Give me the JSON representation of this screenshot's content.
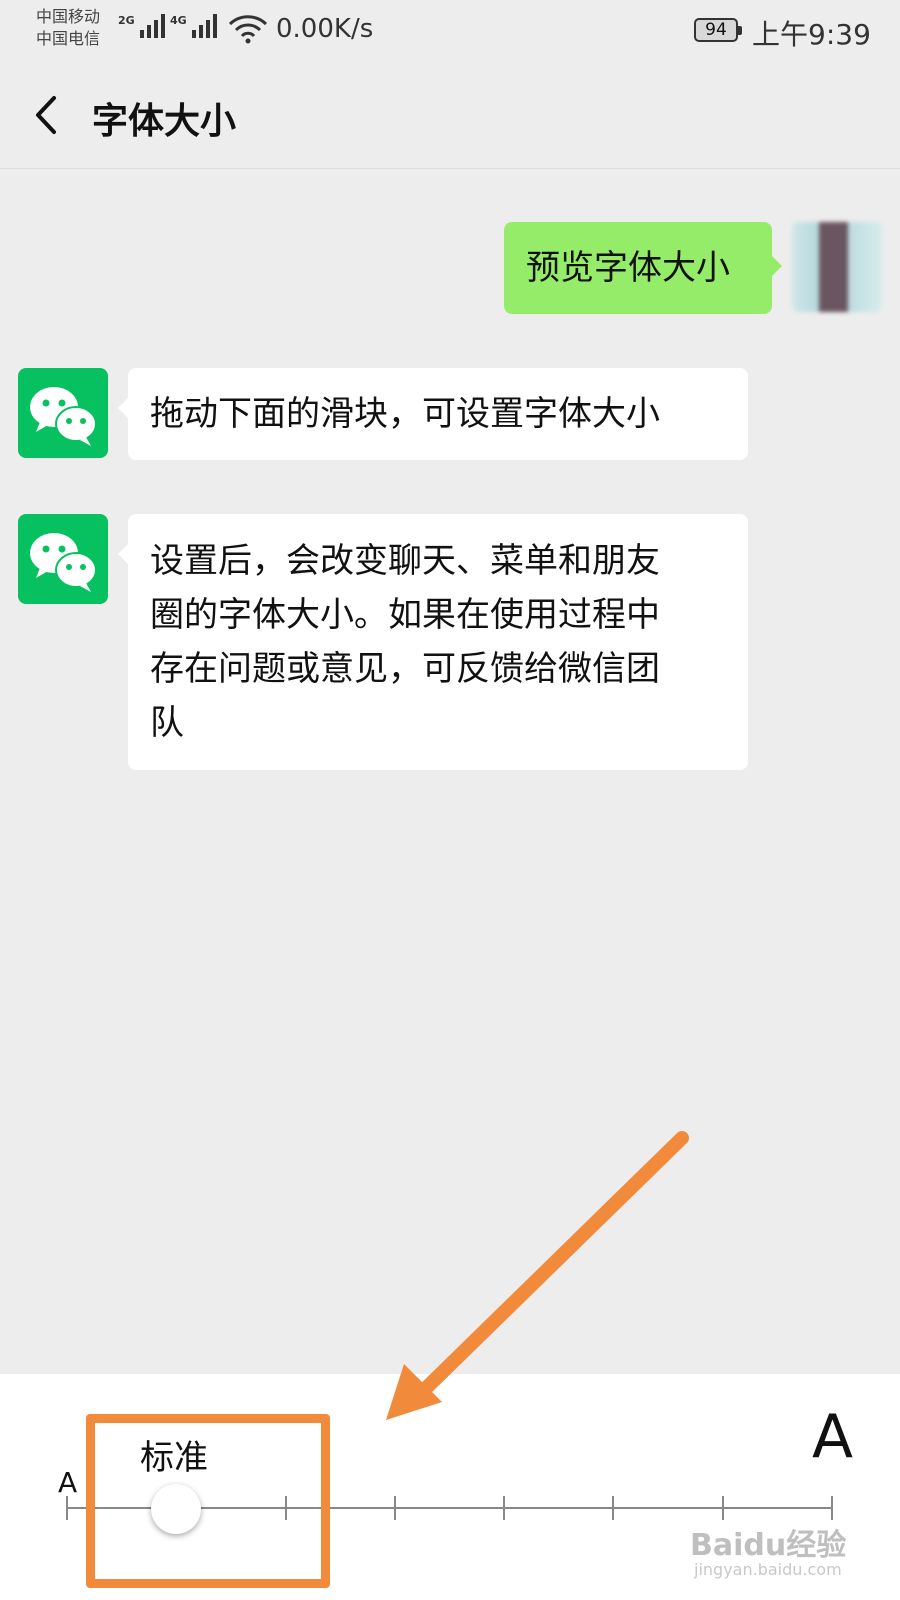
{
  "status_bar": {
    "carrier_1": "中国移动",
    "carrier_2": "中国电信",
    "net_1": "2G",
    "net_2": "4G",
    "speed": "0.00K/s",
    "battery": "94",
    "time": "上午9:39"
  },
  "header": {
    "back_icon": "chevron-left-icon",
    "title": "字体大小"
  },
  "messages": [
    {
      "side": "right",
      "text": "预览字体大小"
    },
    {
      "side": "left",
      "text": "拖动下面的滑块，可设置字体大小"
    },
    {
      "side": "left",
      "lines": [
        "设置后，会改变聊天、菜单和朋友",
        "圈的字体大小。如果在使用过程中",
        "存在问题或意见，可反馈给微信团",
        "队"
      ]
    }
  ],
  "font_slider": {
    "small_label": "A",
    "large_label": "A",
    "current_level_label": "标准",
    "levels": 8,
    "current_level_index": 1
  },
  "watermark": {
    "brand": "Baidu经验",
    "url": "jingyan.baidu.com"
  },
  "colors": {
    "background": "#ededed",
    "sent_bubble": "#95ec69",
    "wechat_green": "#07c160",
    "annotation": "#f28a3c"
  }
}
